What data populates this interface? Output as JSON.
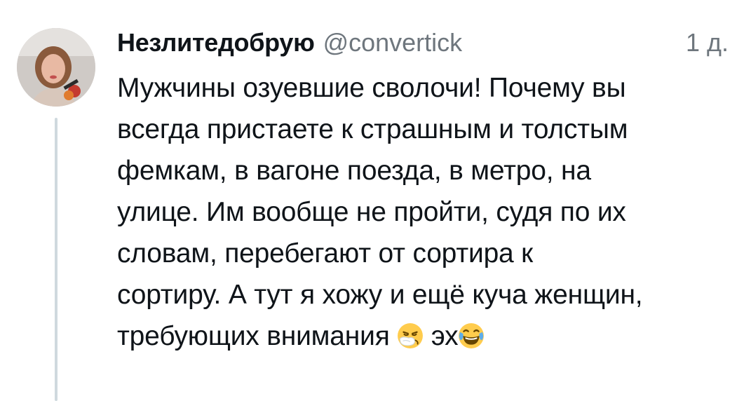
{
  "tweet": {
    "display_name": "Незлитедобрую",
    "handle": "@convertick",
    "time": "1 д.",
    "body_lines": [
      "Мужчины озуевшие сволочи! Почему вы",
      "всегда пристаете к страшным и толстым",
      "фемкам, в вагоне поезда, в метро, на",
      "улице. Им вообще не пройти, судя по их",
      "словам, перебегают от сортира к",
      "сортиру. А тут я хожу и ещё куча женщин,",
      "требующих внимания"
    ],
    "last_line_tail": "эх",
    "emojis": [
      "sneezing-face-icon",
      "tears-of-joy-icon"
    ]
  },
  "colors": {
    "text": "#0f1419",
    "secondary": "#6e767d",
    "thread_line": "#cfd9de"
  }
}
